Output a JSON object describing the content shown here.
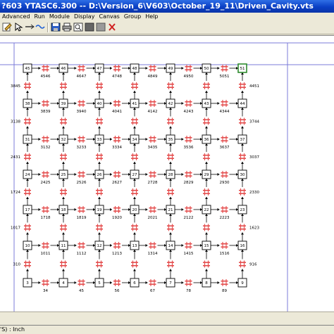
{
  "window": {
    "title": "?603  YTASC6.300 -- D:\\Version_6\\V603\\October_19_11\\Driven_Cavity.vts"
  },
  "menu": [
    "Advanced",
    "Run",
    "Module",
    "Display",
    "Canvas",
    "Group",
    "Help"
  ],
  "toolbar": {
    "icons": [
      "edit-icon",
      "cursor-icon",
      "connect-icon",
      "wave-icon",
      "save-icon",
      "print-icon",
      "zoom-icon",
      "stop-icon",
      "grey-box-icon",
      "close-x-icon"
    ]
  },
  "status": {
    "text": "'S) : Inch"
  },
  "colors": {
    "title_bar": "#0a3fc4",
    "hatch": "#e34b4b",
    "highlight_border": "#2e8b2e"
  },
  "grid": {
    "nodes": [
      [
        "45",
        "46",
        "47",
        "48",
        "49",
        "50",
        "51"
      ],
      [
        "38",
        "39",
        "40",
        "41",
        "42",
        "43",
        "44"
      ],
      [
        "31",
        "32",
        "33",
        "34",
        "35",
        "36",
        "37"
      ],
      [
        "24",
        "25",
        "26",
        "27",
        "28",
        "29",
        "30"
      ],
      [
        "17",
        "18",
        "19",
        "20",
        "21",
        "22",
        "23"
      ],
      [
        "10",
        "11",
        "12",
        "13",
        "14",
        "15",
        "16"
      ],
      [
        "3",
        "4",
        "5",
        "6",
        "7",
        "8",
        "9"
      ]
    ],
    "highlighted_node": "51",
    "h_labels": [
      [
        "4546",
        "4647",
        "4748",
        "4849",
        "4950",
        "5051"
      ],
      [
        "3839",
        "3940",
        "4041",
        "4142",
        "4243",
        "4344"
      ],
      [
        "3132",
        "3233",
        "3334",
        "3435",
        "3536",
        "3637"
      ],
      [
        "2425",
        "2526",
        "2627",
        "2728",
        "2829",
        "2930"
      ],
      [
        "1718",
        "1819",
        "1920",
        "2021",
        "2122",
        "2223"
      ],
      [
        "1011",
        "1112",
        "1213",
        "1314",
        "1415",
        "1516"
      ],
      [
        "34",
        "45",
        "56",
        "67",
        "78",
        "89"
      ]
    ],
    "v_labels": [
      [
        "3845",
        "",
        "",
        "",
        "",
        "",
        "4451"
      ],
      [
        "3138",
        "",
        "",
        "",
        "",
        "",
        "3744"
      ],
      [
        "2431",
        "",
        "",
        "",
        "",
        "",
        "3037"
      ],
      [
        "1724",
        "",
        "",
        "",
        "",
        "",
        "2330"
      ],
      [
        "1017",
        "",
        "",
        "",
        "",
        "",
        "1623"
      ],
      [
        "310",
        "",
        "",
        "",
        "",
        "",
        "916"
      ]
    ]
  }
}
